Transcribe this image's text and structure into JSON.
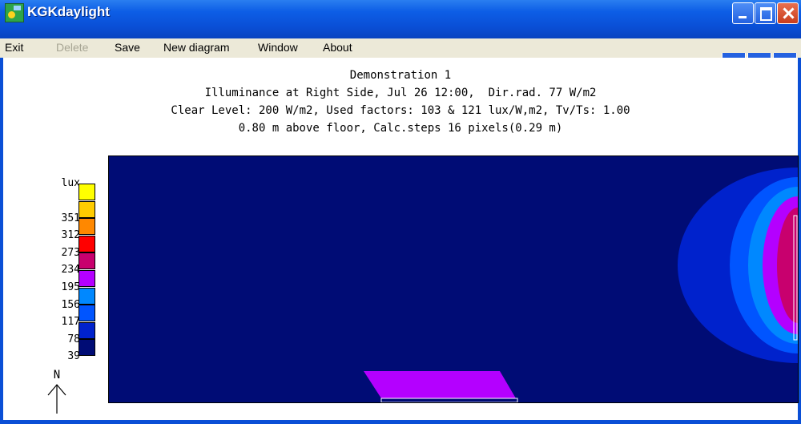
{
  "window": {
    "title": "KGKdaylight"
  },
  "menu": {
    "items": [
      {
        "label": "Exit",
        "enabled": true
      },
      {
        "label": "Delete",
        "enabled": false
      },
      {
        "label": "Save",
        "enabled": true
      },
      {
        "label": "New diagram",
        "enabled": true
      },
      {
        "label": "Window",
        "enabled": true
      },
      {
        "label": "About",
        "enabled": true
      }
    ]
  },
  "diagram": {
    "header": [
      "Demonstration 1",
      "Illuminance at Right Side, Jul 26 12:00,  Dir.rad. 77 W/m2",
      "Clear Level: 200 W/m2, Used factors: 103 & 121 lux/W,m2, Tv/Ts: 1.00",
      "0.80 m above floor, Calc.steps 16 pixels(0.29 m)"
    ],
    "legend_unit": "lux",
    "legend": [
      {
        "label": "",
        "color": "#ffff00"
      },
      {
        "label": "351",
        "color": "#ffcc00"
      },
      {
        "label": "312",
        "color": "#ff8800"
      },
      {
        "label": "273",
        "color": "#ff0000"
      },
      {
        "label": "234",
        "color": "#c8006e"
      },
      {
        "label": "195",
        "color": "#b400ff"
      },
      {
        "label": "156",
        "color": "#0088ff"
      },
      {
        "label": "117",
        "color": "#0055ff"
      },
      {
        "label": "78",
        "color": "#0022cc"
      },
      {
        "label": "39",
        "color": "#000c75"
      }
    ],
    "north_label": "N",
    "colors": {
      "background": "#000c75",
      "zone_78": "#0022cc",
      "zone_117": "#0055ff",
      "zone_156": "#0088ff",
      "zone_195": "#b400ff",
      "zone_234": "#c8006e",
      "floor_patch": "#b400ff"
    }
  }
}
